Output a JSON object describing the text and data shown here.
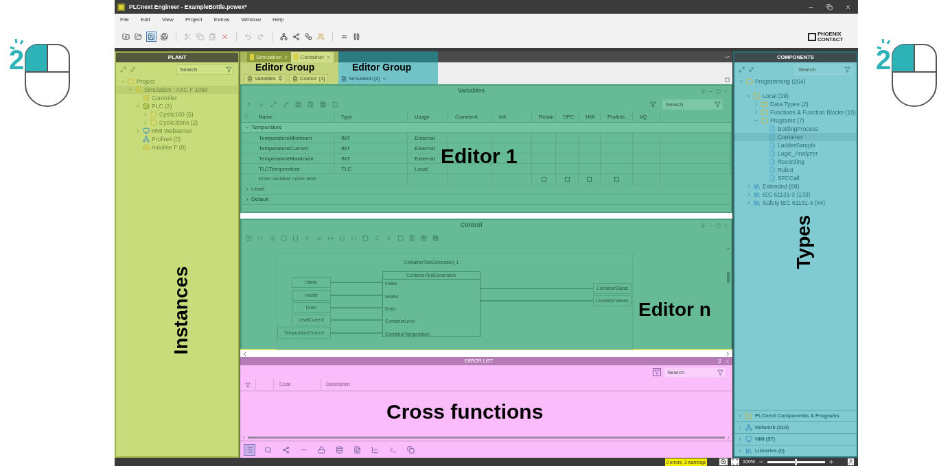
{
  "step_badges": [
    "2",
    "2"
  ],
  "window": {
    "title": "PLCnext Engineer - ExampleBottle.pcwex*"
  },
  "menu": [
    "File",
    "Edit",
    "View",
    "Project",
    "Extras",
    "Window",
    "Help"
  ],
  "logo": {
    "line1": "PHOENIX",
    "line2": "CONTACT"
  },
  "plant": {
    "title": "PLANT",
    "search": {
      "placeholder": "Search"
    },
    "overlay_label": "Instances",
    "tree": [
      {
        "label": "Project",
        "kind": "folder",
        "expanded": true,
        "selected": false,
        "children": [
          {
            "label": "Simulation : AXC F 1050",
            "kind": "device",
            "expanded": true,
            "selected": true,
            "children": [
              {
                "label": "Controller",
                "kind": "controller",
                "selected": false
              },
              {
                "label": "PLC (2)",
                "kind": "plc",
                "expanded": true,
                "selected": false,
                "children": [
                  {
                    "label": "Cyclic100 (5)",
                    "kind": "task",
                    "expanded": false,
                    "selected": false
                  },
                  {
                    "label": "Cyclic30ms (2)",
                    "kind": "task",
                    "expanded": false,
                    "selected": false
                  }
                ]
              },
              {
                "label": "HMI Webserver",
                "kind": "hmi",
                "expanded": false,
                "selected": false
              },
              {
                "label": "Profinet (0)",
                "kind": "network",
                "selected": false
              },
              {
                "label": "Axioline F (0)",
                "kind": "io",
                "selected": false
              }
            ]
          }
        ]
      }
    ]
  },
  "editor_group": {
    "overlay_labels": [
      "Editor Group",
      "Editor Group"
    ],
    "tabs": [
      {
        "label": "Simulation",
        "selected": false
      },
      {
        "label": "Container",
        "selected": true
      }
    ],
    "subtabs": [
      {
        "label": "Variables",
        "kind": "pinned"
      },
      {
        "label": "Control  [1]",
        "kind": "plain"
      },
      {
        "label": "Simulation [2]",
        "kind": "dropdown"
      }
    ]
  },
  "variables": {
    "title": "Variables",
    "overlay_label": "Editor 1",
    "search": {
      "placeholder": "Search"
    },
    "columns": [
      "Name",
      "Type",
      "Usage",
      "Comment",
      "Init",
      "Retain",
      "OPC",
      "HMI",
      "Proficlo...",
      "I/Q"
    ],
    "groups": [
      {
        "label": "Temperature",
        "expanded": true,
        "selected": true,
        "rows": [
          [
            "TemperatureMinimum",
            "INT",
            "External"
          ],
          [
            "TemperatureCurrent",
            "INT",
            "External"
          ],
          [
            "TemperatureMaximum",
            "INT",
            "External"
          ],
          [
            "TLCTemperature",
            "TLC",
            "Local"
          ]
        ]
      },
      {
        "label": "Level",
        "expanded": false,
        "selected": false
      },
      {
        "label": "Default",
        "expanded": false,
        "selected": false
      }
    ],
    "new_row": {
      "placeholder": "Enter variable name here",
      "flags": [
        {
          "checked": false
        },
        {
          "checked": false
        },
        {
          "checked": false
        },
        {
          "checked": false
        }
      ]
    }
  },
  "control": {
    "title": "Control",
    "overlay_label": "Editor n",
    "block": {
      "instance": "ContainerTextGeneration_1",
      "type": "ContainerTextGeneration",
      "inputs": [
        "Intake",
        "Heater",
        "Drain",
        "ContainerLevel",
        "ContainerTemperature"
      ]
    },
    "input_variables": [
      "Intake",
      "Heater",
      "Drain",
      "LevelCurrent",
      "TemperatureCurrent"
    ],
    "output_variables": [
      "ContainerStatus",
      "ContainerValues"
    ]
  },
  "error_list": {
    "title": "ERROR LIST",
    "search": {
      "placeholder": "Search"
    },
    "columns": [
      "Code",
      "Description"
    ],
    "overlay_label": "Cross functions"
  },
  "components": {
    "title": "COMPONENTS",
    "search": {
      "placeholder": "Search"
    },
    "overlay_label": "Types",
    "tree": [
      {
        "label": "Programming (264)",
        "kind": "folder",
        "expanded": true,
        "selected": false,
        "children": [
          {
            "label": "Local (19)",
            "kind": "folder",
            "expanded": true,
            "selected": false,
            "children": [
              {
                "label": "Data Types (2)",
                "kind": "folder",
                "expanded": false,
                "selected": false
              },
              {
                "label": "Functions & Function Blocks (10)",
                "kind": "folder",
                "expanded": false,
                "selected": false
              },
              {
                "label": "Programs (7)",
                "kind": "folder",
                "expanded": true,
                "selected": false,
                "children": [
                  {
                    "label": "BottlingProcess",
                    "kind": "program",
                    "selected": false
                  },
                  {
                    "label": "Container",
                    "kind": "program",
                    "selected": true
                  },
                  {
                    "label": "LadderSample",
                    "kind": "program",
                    "selected": false
                  },
                  {
                    "label": "Logic_Analyzer",
                    "kind": "program",
                    "selected": false
                  },
                  {
                    "label": "Recording",
                    "kind": "program",
                    "selected": false
                  },
                  {
                    "label": "Robot",
                    "kind": "program",
                    "selected": false
                  },
                  {
                    "label": "SFCCall",
                    "kind": "program",
                    "selected": false
                  }
                ]
              }
            ]
          },
          {
            "label": "Extended (68)",
            "kind": "library",
            "expanded": false,
            "selected": false
          },
          {
            "label": "IEC 61131-3 (133)",
            "kind": "library",
            "expanded": false,
            "selected": false
          },
          {
            "label": "Safety IEC 61131-3 (44)",
            "kind": "library",
            "expanded": false,
            "selected": false
          }
        ]
      }
    ],
    "sections": [
      {
        "label": "PLCnext Components & Programs",
        "kind": "folder"
      },
      {
        "label": "Network (319)",
        "kind": "network"
      },
      {
        "label": "HMI (57)",
        "kind": "hmi"
      },
      {
        "label": "Libraries (0)",
        "kind": "library"
      }
    ]
  },
  "status_bar": {
    "messages": "0 errors, 3 warnings",
    "zoom": "100%",
    "zoom_slider": {
      "level": 0.5
    }
  }
}
